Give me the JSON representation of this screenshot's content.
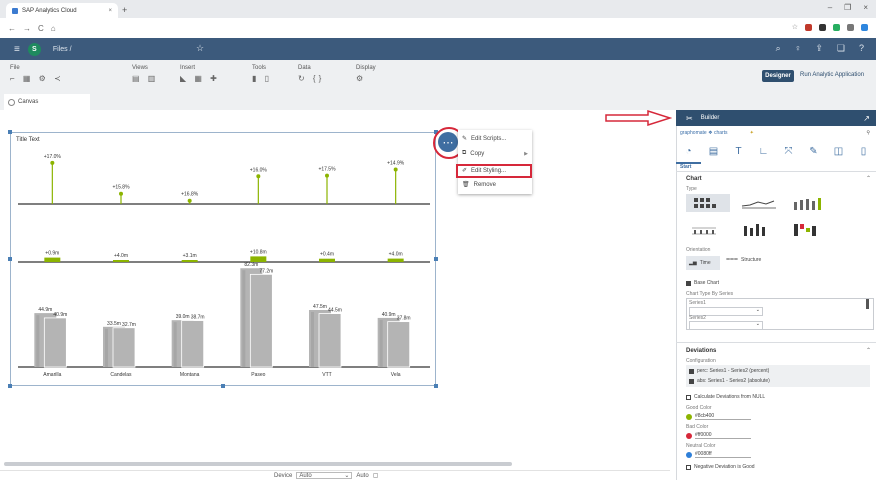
{
  "browser": {
    "tab_title": "SAP Analytics Cloud",
    "tab_close": "×",
    "new_tab": "+",
    "window_controls": [
      "–",
      "❐",
      "×"
    ],
    "nav": [
      "←",
      "→",
      "C",
      "⌂"
    ]
  },
  "shell": {
    "breadcrumb": "Files /",
    "logo_letter": "S"
  },
  "toolbar": {
    "groups": [
      {
        "label": "File",
        "icons": "⌐ ▦ ⚙ ≺"
      },
      {
        "label": "Views",
        "icons": "▤ ▥"
      },
      {
        "label": "Insert",
        "icons": "◣ ▦ ✚"
      },
      {
        "label": "Tools",
        "icons": "▮ ▯"
      },
      {
        "label": "Data",
        "icons": "↻ {}"
      },
      {
        "label": "Display",
        "icons": "⚙"
      }
    ],
    "designer_label": "Designer",
    "run_label": "Run Analytic Application"
  },
  "canvas_tab": "Canvas",
  "chart": {
    "title": "Title Text",
    "categories": [
      "Amarilla",
      "Candelas",
      "Montana",
      "Paseo",
      "VTT",
      "Vela"
    ],
    "colors": {
      "series": "#b4b4b4",
      "series_dark": "#8c8c8c",
      "positive": "#8cb400",
      "axis": "#333333"
    }
  },
  "chart_data": {
    "type": "bar",
    "categories": [
      "Amarilla",
      "Candelas",
      "Montana",
      "Paseo",
      "VTT",
      "Vela"
    ],
    "series": [
      {
        "values": [
          44.9,
          33.5,
          39.0,
          82.3,
          47.5,
          40.9
        ]
      },
      {
        "values": [
          40.9,
          32.7,
          38.7,
          77.2,
          44.5,
          37.8
        ]
      }
    ],
    "deviation_abs_labels": [
      "+0.9m",
      "+4.0m",
      "+3.1m",
      "+10.8m",
      "+0.4m",
      "+4.0m"
    ],
    "deviation_pct_labels": [
      "+17.0%",
      "+15.8%",
      "+16.8%",
      "+16.0%",
      "+17.5%",
      "+14.9%"
    ]
  },
  "context_menu": {
    "button_icon": "⋯",
    "items": [
      {
        "icon": "✎",
        "label": "Edit Scripts..."
      },
      {
        "icon": "⧉",
        "label": "Copy"
      },
      {
        "icon": "✐",
        "label": "Edit Styling..."
      },
      {
        "icon": "🗑",
        "label": "Remove"
      }
    ]
  },
  "builder": {
    "title": "Builder",
    "package": "graphomate ❖ charts",
    "section_start": "Start",
    "chart_header": "Chart",
    "type_label": "Type",
    "orientation_label": "Orientation",
    "orientation_time": "Time",
    "orientation_structure": "Structure",
    "base_chart": "Base Chart",
    "chart_type_by_series": "Chart Type By Series",
    "series1": "Series1",
    "series2": "Series2",
    "deviations_header": "Deviations",
    "configuration_label": "Configuration",
    "config_items": [
      "perc: Series1 - Series2 (percent)",
      "abs: Series1 - Series2 (absolute)"
    ],
    "calc_null": "Calculate Deviations from NULL",
    "good_color_label": "Good Color",
    "good_color": "#8cb400",
    "bad_color_label": "Bad Color",
    "bad_color": "#ff0000",
    "neutral_color_label": "Neutral Color",
    "neutral_color": "#0080ff",
    "negative_good": "Negative Deviation is Good"
  },
  "status": {
    "device_label": "Device",
    "device_value": "Auto",
    "auto_label": "Auto"
  }
}
